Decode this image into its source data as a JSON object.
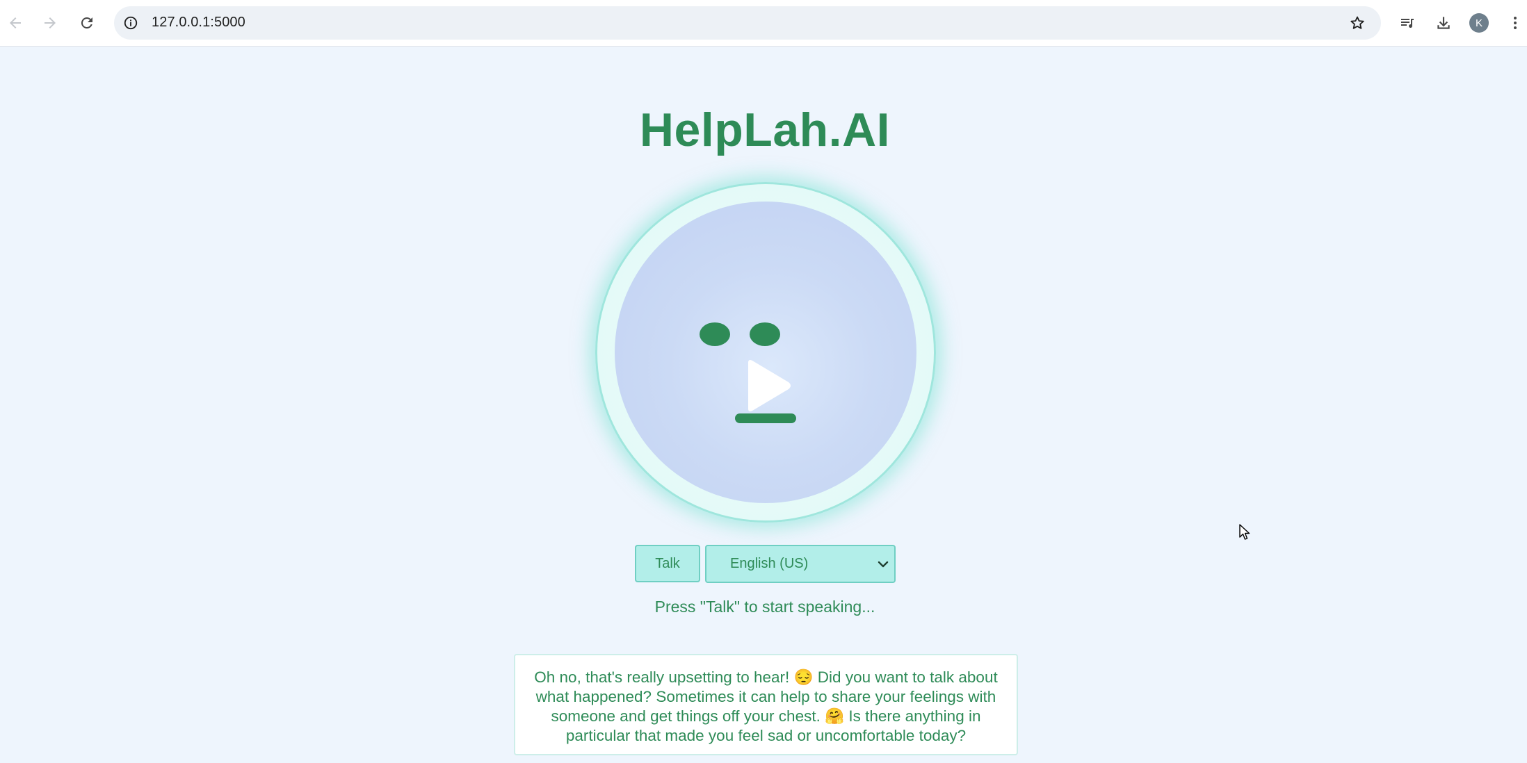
{
  "browser": {
    "url": "127.0.0.1:5000",
    "profile_initial": "K",
    "icons": {
      "back": "arrow-left-icon",
      "forward": "arrow-right-icon",
      "reload": "reload-icon",
      "site_info": "info-icon",
      "bookmark": "star-icon",
      "media": "playlist-icon",
      "downloads": "download-icon",
      "menu": "kebab-menu-icon"
    }
  },
  "app": {
    "title": "HelpLah.AI",
    "talk_label": "Talk",
    "language": {
      "selected": "English (US)"
    },
    "status": "Press \"Talk\" to start speaking...",
    "response": "Oh no, that's really upsetting to hear! 😔 Did you want to talk about what happened? Sometimes it can help to share your feelings with someone and get things off your chest. 🤗 Is there anything in particular that made you feel sad or uncomfortable today?"
  },
  "colors": {
    "accent": "#2e8b57",
    "button_bg": "#b2eee9",
    "page_bg": "#eef5fd",
    "face_bg": "#c8d8f4"
  }
}
